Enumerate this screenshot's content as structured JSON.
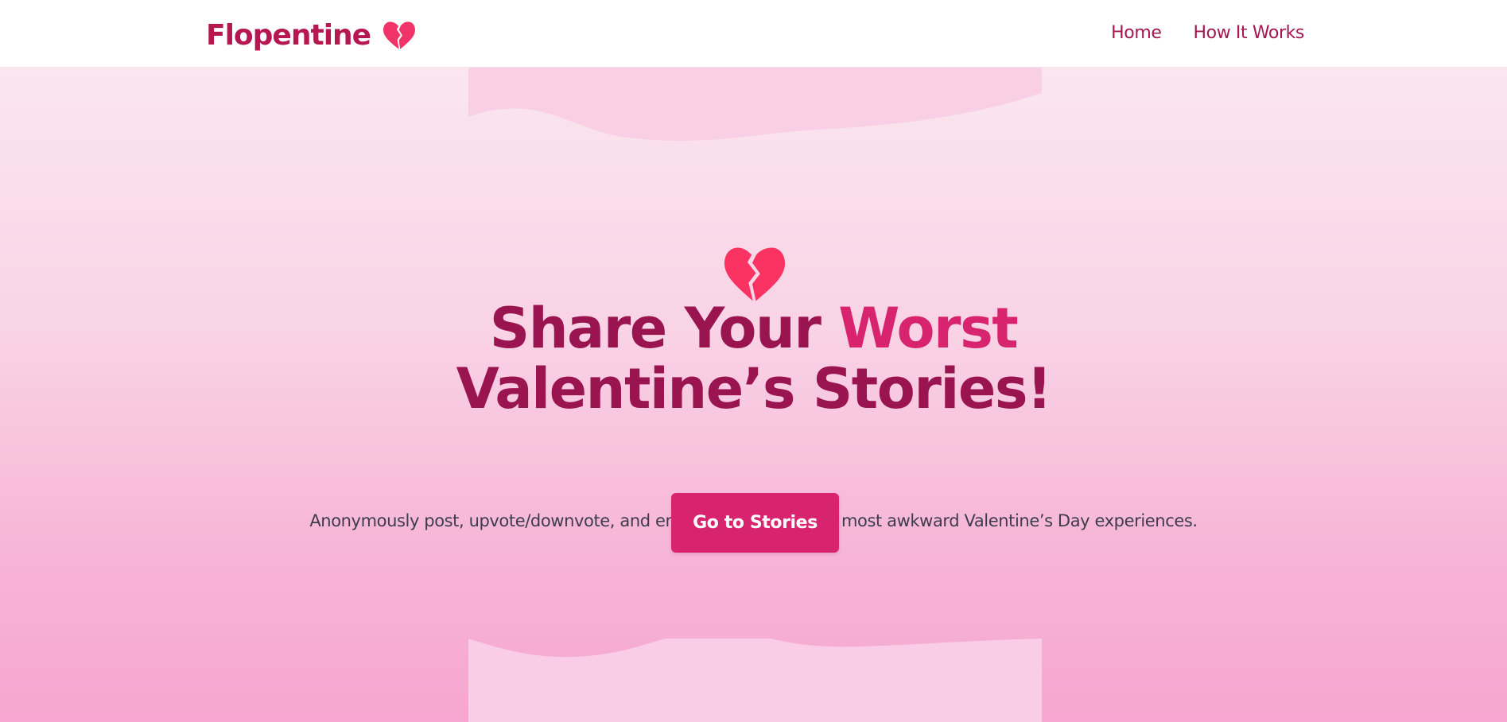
{
  "brand": {
    "name": "Flopentine",
    "icon": "broken-heart-icon"
  },
  "nav": {
    "items": [
      {
        "label": "Home"
      },
      {
        "label": "How It Works"
      }
    ]
  },
  "hero": {
    "icon": "broken-heart-icon",
    "headline_part1": "Share Your ",
    "headline_accent": "Worst",
    "headline_part2": "Valentine’s Stories!",
    "subtext": "Anonymously post, upvote/downvote, and enjoy the funniest and most awkward Valentine’s Day experiences.",
    "cta_label": "Go to Stories"
  },
  "colors": {
    "brand": "#b5174f",
    "headline": "#9a1550",
    "accent": "#d8246e",
    "heart": "#fb3363",
    "hero_gradient_top": "#fae6ef",
    "hero_gradient_bottom": "#f6a6d0"
  }
}
